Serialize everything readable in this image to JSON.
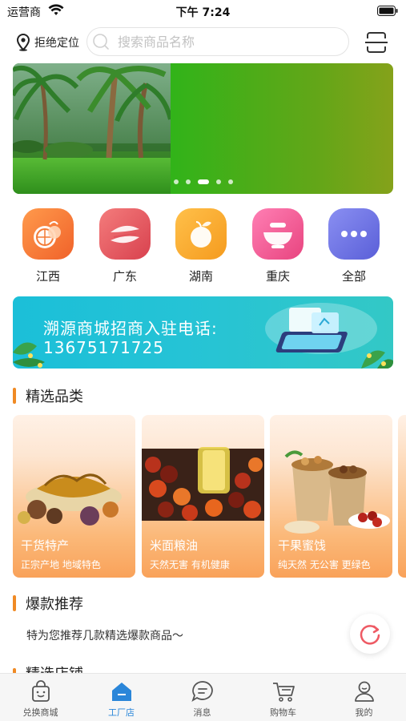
{
  "status_bar": {
    "carrier": "运营商",
    "time": "下午 7:24"
  },
  "header": {
    "location_label": "拒绝定位",
    "search_placeholder": "搜索商品名称"
  },
  "regions": [
    {
      "label": "江西",
      "icon": "orange-fruit-icon",
      "color": "#f5732f"
    },
    {
      "label": "广东",
      "icon": "leaf-icon",
      "color": "#e4505a"
    },
    {
      "label": "湖南",
      "icon": "peach-fruit-icon",
      "color": "#f7a52a"
    },
    {
      "label": "重庆",
      "icon": "bowl-icon",
      "color": "#ef4f8f"
    },
    {
      "label": "全部",
      "icon": "more-dots-icon",
      "color": "#6a6fe3"
    }
  ],
  "promo": {
    "title": "溯源商城招商入驻电话:",
    "phone": "13675171725"
  },
  "featured": {
    "title": "精选品类",
    "cards": [
      {
        "title": "干货特产",
        "subtitle": "正宗产地 地域特色"
      },
      {
        "title": "米面粮油",
        "subtitle": "天然无害 有机健康"
      },
      {
        "title": "干果蜜饯",
        "subtitle": "纯天然 无公害 更绿色"
      }
    ]
  },
  "hot": {
    "title": "爆款推荐",
    "subtitle": "特为您推荐几款精选爆款商品～"
  },
  "next_section": {
    "title": "精选店铺"
  },
  "tabs": [
    {
      "label": "兑换商城",
      "icon": "shopping-bag-icon"
    },
    {
      "label": "工厂店",
      "icon": "factory-home-icon",
      "active": true
    },
    {
      "label": "消息",
      "icon": "message-icon"
    },
    {
      "label": "购物车",
      "icon": "cart-icon"
    },
    {
      "label": "我的",
      "icon": "profile-icon"
    }
  ],
  "colors": {
    "accent": "#f08a24",
    "tab_active": "#2a86d9",
    "promo": "#1bbfd8"
  }
}
